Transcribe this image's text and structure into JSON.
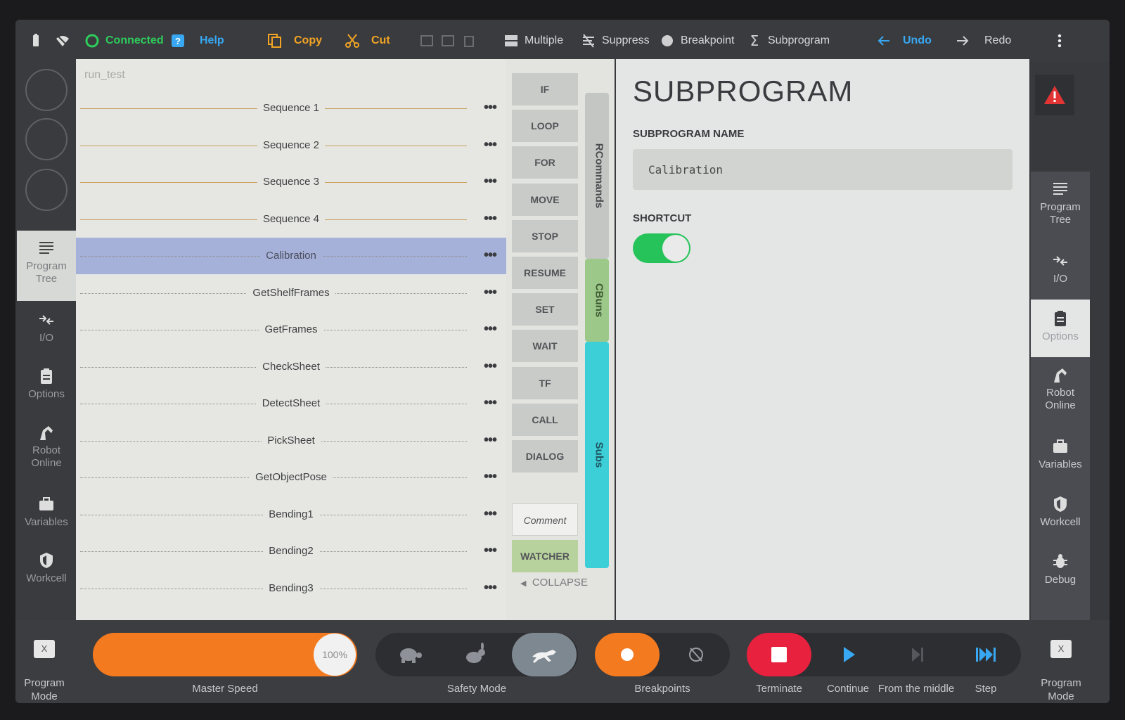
{
  "topbar": {
    "connected": "Connected",
    "help": "Help",
    "copy": "Copy",
    "cut": "Cut",
    "multiple": "Multiple",
    "suppress": "Suppress",
    "breakpoint": "Breakpoint",
    "subprogram": "Subprogram",
    "undo": "Undo",
    "redo": "Redo"
  },
  "left_rail": [
    {
      "label": "Program Tree",
      "icon": "list-icon"
    },
    {
      "label": "I/O",
      "icon": "io-arrows-icon"
    },
    {
      "label": "Options",
      "icon": "clipboard-icon"
    },
    {
      "label": "Robot Online",
      "icon": "robot-arm-icon"
    },
    {
      "label": "Variables",
      "icon": "briefcase-icon"
    },
    {
      "label": "Workcell",
      "icon": "shield-icon"
    }
  ],
  "tree": {
    "root": "run_test",
    "items": [
      {
        "label": "Sequence 1",
        "kind": "sequence"
      },
      {
        "label": "Sequence 2",
        "kind": "sequence"
      },
      {
        "label": "Sequence 3",
        "kind": "sequence"
      },
      {
        "label": "Sequence 4",
        "kind": "sequence"
      },
      {
        "label": "Calibration",
        "kind": "sub",
        "selected": true
      },
      {
        "label": "GetShelfFrames",
        "kind": "sub"
      },
      {
        "label": "GetFrames",
        "kind": "sub"
      },
      {
        "label": "CheckSheet",
        "kind": "sub"
      },
      {
        "label": "DetectSheet",
        "kind": "sub"
      },
      {
        "label": "PickSheet",
        "kind": "sub"
      },
      {
        "label": "GetObjectPose",
        "kind": "sub"
      },
      {
        "label": "Bending1",
        "kind": "sub"
      },
      {
        "label": "Bending2",
        "kind": "sub"
      },
      {
        "label": "Bending3",
        "kind": "sub"
      }
    ]
  },
  "palette": {
    "commands": [
      "IF",
      "LOOP",
      "FOR",
      "MOVE",
      "STOP",
      "RESUME",
      "SET",
      "WAIT",
      "TF",
      "CALL",
      "DIALOG"
    ],
    "comment": "Comment",
    "watcher": "WATCHER",
    "tabs": {
      "rcommands": "RCommands",
      "cbuns": "CBuns",
      "subs": "Subs"
    },
    "collapse": "COLLAPSE",
    "colors": {
      "rcommands": "#c4c6c3",
      "cbuns": "#9cc88a",
      "subs": "#3ccfd8"
    }
  },
  "props": {
    "title": "SUBPROGRAM",
    "name_label": "SUBPROGRAM NAME",
    "name_value": "Calibration",
    "shortcut_label": "SHORTCUT",
    "shortcut_on": true
  },
  "right_rail": [
    {
      "label": "Program Tree",
      "icon": "list-icon"
    },
    {
      "label": "I/O",
      "icon": "io-arrows-icon"
    },
    {
      "label": "Options",
      "icon": "clipboard-icon"
    },
    {
      "label": "Robot Online",
      "icon": "robot-arm-icon"
    },
    {
      "label": "Variables",
      "icon": "briefcase-icon"
    },
    {
      "label": "Workcell",
      "icon": "shield-icon"
    },
    {
      "label": "Debug",
      "icon": "bug-icon"
    }
  ],
  "bottom": {
    "program_mode": "Program Mode",
    "x": "X",
    "master_speed": "Master Speed",
    "speed_value": "100%",
    "safety_mode": "Safety Mode",
    "breakpoints": "Breakpoints",
    "terminate": "Terminate",
    "continue": "Continue",
    "from_middle": "From the middle",
    "step": "Step"
  }
}
